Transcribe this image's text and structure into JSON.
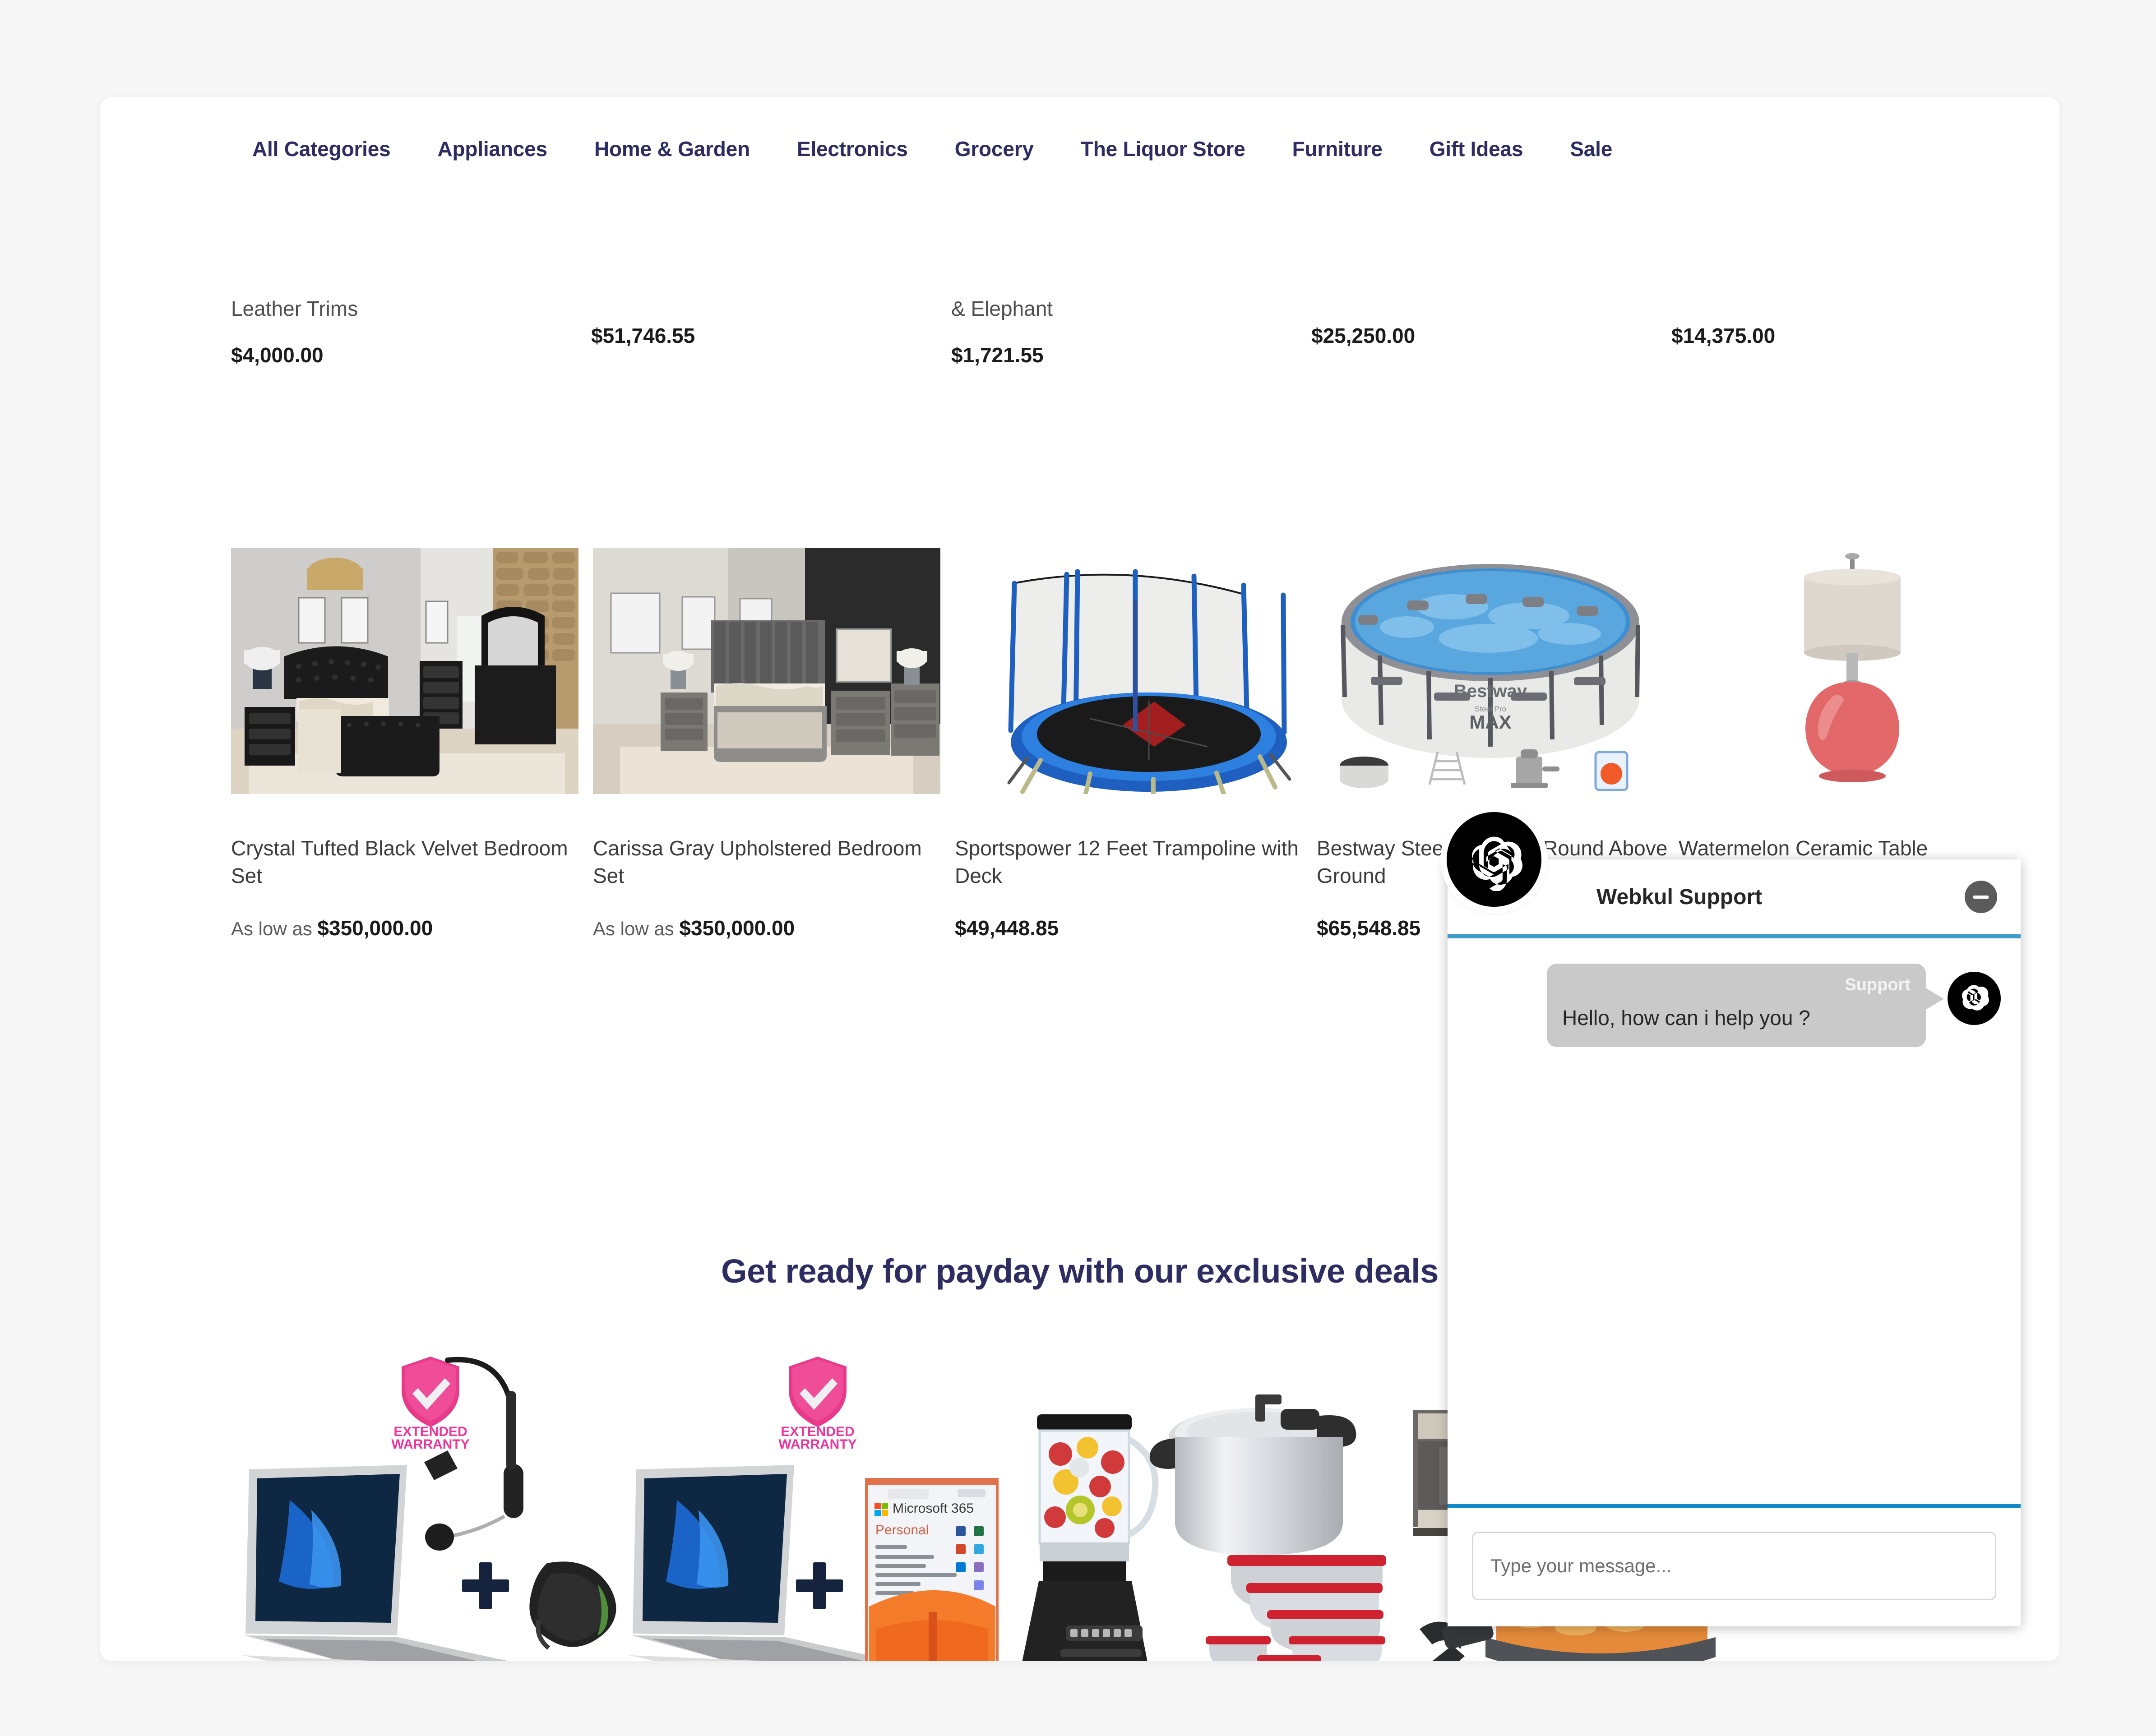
{
  "nav": {
    "items": [
      {
        "label": "All Categories"
      },
      {
        "label": "Appliances"
      },
      {
        "label": "Home & Garden"
      },
      {
        "label": "Electronics"
      },
      {
        "label": "Grocery"
      },
      {
        "label": "The Liquor Store"
      },
      {
        "label": "Furniture"
      },
      {
        "label": "Gift Ideas"
      },
      {
        "label": "Sale"
      }
    ]
  },
  "top_row": [
    {
      "name": "Leather Trims",
      "price": "$4,000.00"
    },
    {
      "name": "",
      "price": "$51,746.55"
    },
    {
      "name": "& Elephant",
      "price": "$1,721.55"
    },
    {
      "name": "",
      "price": "$25,250.00"
    },
    {
      "name": "",
      "price": "$14,375.00"
    }
  ],
  "products": [
    {
      "title": "Crystal Tufted Black Velvet Bedroom Set",
      "price_prefix": "As low as ",
      "price": "$350,000.00",
      "image": "black-velvet-bedroom-set-image"
    },
    {
      "title": "Carissa Gray Upholstered Bedroom Set",
      "price_prefix": "As low as ",
      "price": "$350,000.00",
      "image": "gray-upholstered-bedroom-set-image"
    },
    {
      "title": "Sportspower 12 Feet Trampoline with Deck",
      "price_prefix": "",
      "price": "$49,448.85",
      "image": "trampoline-image"
    },
    {
      "title": "Bestway Steel Pro MAX Round Above Ground",
      "price_prefix": "",
      "price": "$65,548.85",
      "image": "above-ground-pool-image"
    },
    {
      "title": "Watermelon Ceramic Table",
      "price_prefix": "",
      "price": "",
      "image": "ceramic-table-lamp-image"
    }
  ],
  "banner": {
    "title": "Get ready for payday with our exclusive deals",
    "items": [
      {
        "name": "laptop-headset-mouse-bundle",
        "badge": "EXTENDED WARRANTY"
      },
      {
        "name": "laptop-microsoft365-bundle",
        "badge": "EXTENDED WARRANTY"
      },
      {
        "name": "blender-pressure-cooker-bowls-bundle",
        "badge": ""
      },
      {
        "name": "microwave-electric-skillet-bundle",
        "badge": ""
      }
    ]
  },
  "chat": {
    "title": "Webkul Support",
    "minimize_label": "",
    "messages": [
      {
        "sender": "Support",
        "text": "Hello, how can i help you ?"
      }
    ],
    "input_placeholder": "Type your message...",
    "accent_color": "#1389c6",
    "header_accent_color": "#3b9dc7",
    "bubble_color": "#c9c9c9"
  },
  "theme": {
    "nav_color": "#2e2d62",
    "page_bg": "#f7f7f8",
    "card_bg": "#ffffff",
    "badge_pink": "#ef3d8c"
  }
}
